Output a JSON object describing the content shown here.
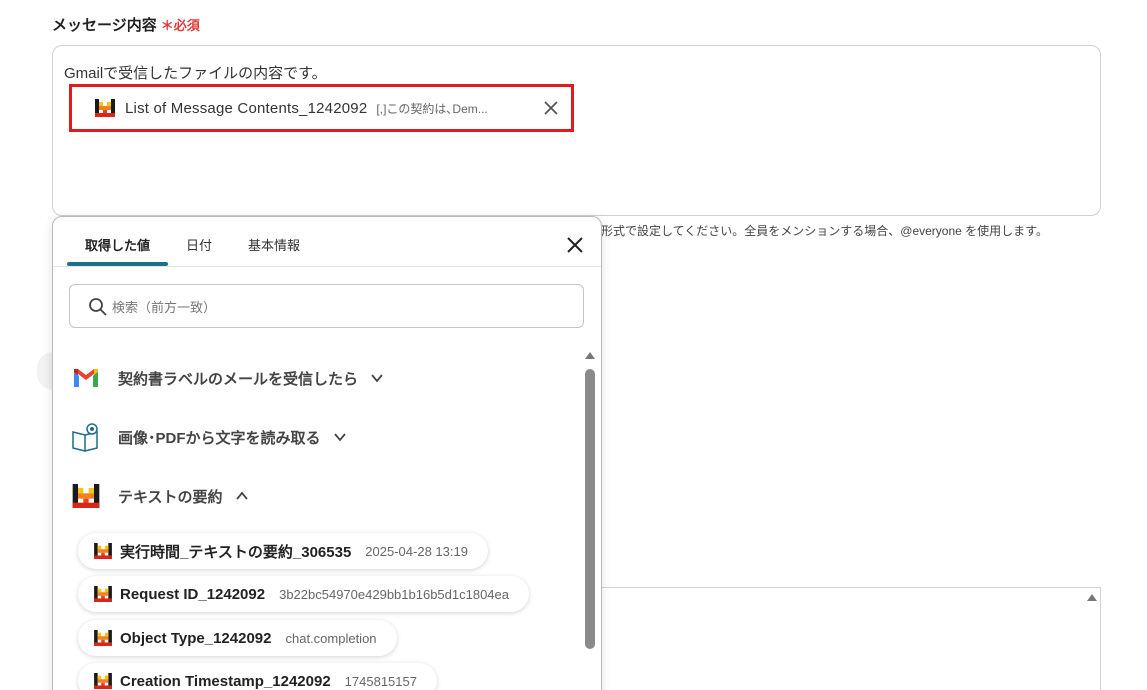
{
  "field": {
    "label": "メッセージ内容",
    "required_mark": "＊",
    "required_label": "必須",
    "text": "Gmailで受信したファイルの内容です。",
    "chip": {
      "name": "List of Message Contents_1242092",
      "preview": "[,]この契約は､Dem..."
    },
    "hint": "形式で設定してください。全員をメンションする場合、@everyone を使用します。"
  },
  "panel": {
    "tabs": [
      {
        "label": "取得した値",
        "active": true
      },
      {
        "label": "日付",
        "active": false
      },
      {
        "label": "基本情報",
        "active": false
      }
    ],
    "search_placeholder": "検索（前方一致）",
    "groups": [
      {
        "label": "契約書ラベルのメールを受信したら",
        "icon": "gmail-icon",
        "expanded": false
      },
      {
        "label": "画像･PDFから文字を読み取る",
        "icon": "ocr-book-icon",
        "expanded": false
      },
      {
        "label": "テキストの要約",
        "icon": "ai-m-icon",
        "expanded": true
      }
    ],
    "items": [
      {
        "name": "実行時間_テキストの要約_306535",
        "value": "2025-04-28 13:19"
      },
      {
        "name": "Request ID_1242092",
        "value": "3b22bc54970e429bb1b16b5d1c1804ea"
      },
      {
        "name": "Object Type_1242092",
        "value": "chat.completion"
      },
      {
        "name": "Creation Timestamp_1242092",
        "value": "1745815157"
      }
    ]
  },
  "colors": {
    "accent": "#1d6f8c",
    "required": "#e03c3c",
    "highlight": "#e01b1b"
  }
}
